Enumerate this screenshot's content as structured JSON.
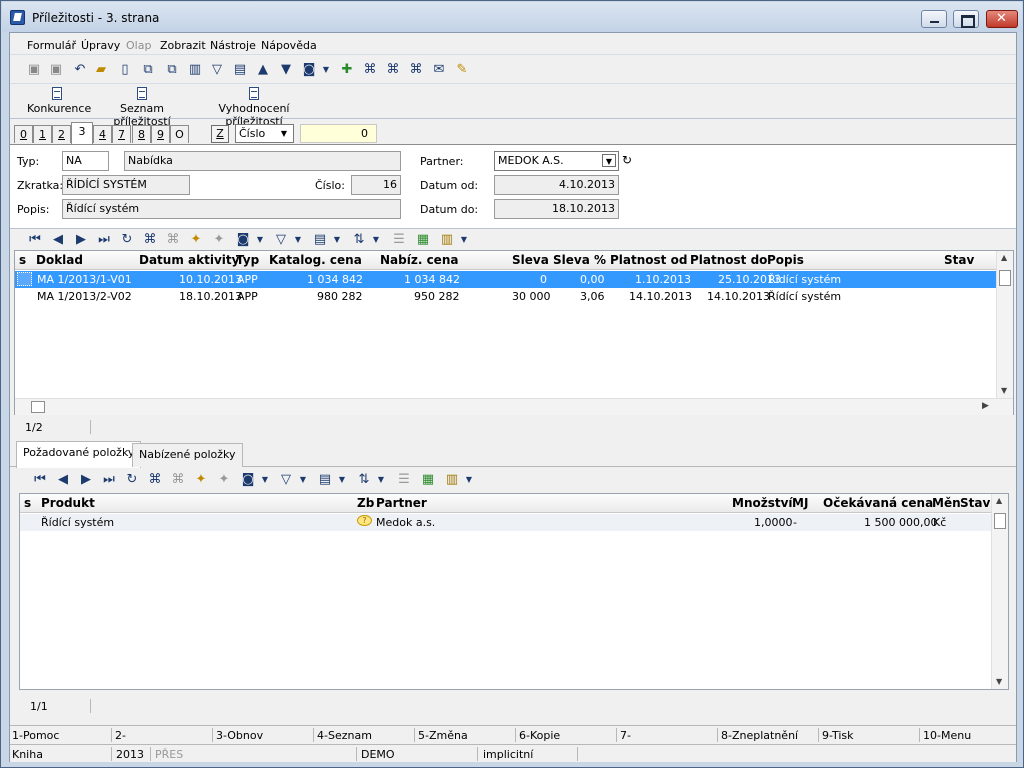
{
  "window": {
    "title": "Příležitosti - 3. strana"
  },
  "menu": [
    "Formulář",
    "Úpravy",
    "Olap",
    "Zobrazit",
    "Nástroje",
    "Nápověda"
  ],
  "actions": [
    "Konkurence",
    "Seznam příležitostí",
    "Vyhodnocení příležitostí"
  ],
  "tabs": [
    "0",
    "1",
    "2",
    "3",
    "4",
    "7",
    "8",
    "9",
    "O"
  ],
  "active_tab": "3",
  "filter": {
    "z_label": "Z",
    "sort_select": "Číslo",
    "number": "0"
  },
  "form": {
    "typ_label": "Typ:",
    "typ_code": "NA",
    "typ_name": "Nabídka",
    "zkratka_label": "Zkratka:",
    "zkratka": "ŘÍDÍCÍ SYSTÉM",
    "cislo_label": "Číslo:",
    "cislo": "16",
    "popis_label": "Popis:",
    "popis": "Řídící systém",
    "partner_label": "Partner:",
    "partner": "MEDOK A.S.",
    "datum_od_label": "Datum od:",
    "datum_od": "4.10.2013",
    "datum_do_label": "Datum do:",
    "datum_do": "18.10.2013"
  },
  "offers": {
    "columns": [
      "s",
      "Doklad",
      "Datum aktivity",
      "Typ",
      "Katalog. cena",
      "Nabíz. cena",
      "Sleva",
      "Sleva %",
      "Platnost od",
      "Platnost do",
      "Popis",
      "Stav"
    ],
    "rows": [
      {
        "doklad": "MA 1/2013/1-V01",
        "datum": "10.10.2013",
        "typ": "APP",
        "katalog": "1 034 842",
        "nabiz": "1 034 842",
        "sleva": "0",
        "sleva_pct": "0,00",
        "od": "1.10.2013",
        "do": "25.10.2013",
        "popis": "Řídící systém",
        "stav": ""
      },
      {
        "doklad": "MA 1/2013/2-V02",
        "datum": "18.10.2013",
        "typ": "APP",
        "katalog": "980 282",
        "nabiz": "950 282",
        "sleva": "30 000",
        "sleva_pct": "3,06",
        "od": "14.10.2013",
        "do": "14.10.2013",
        "popis": "Řídící systém",
        "stav": ""
      }
    ],
    "count": "1/2"
  },
  "bottom_tabs": [
    "Požadované položky",
    "Nabízené položky"
  ],
  "items": {
    "columns": [
      "s",
      "Produkt",
      "Zb",
      "Partner",
      "Množství",
      "MJ",
      "Očekávaná cena",
      "Měn",
      "Stav"
    ],
    "rows": [
      {
        "produkt": "Řídící systém",
        "partner": "Medok a.s.",
        "mnozstvi": "1,0000",
        "mj": "-",
        "cena": "1 500 000,00",
        "men": "Kč",
        "stav": ""
      }
    ],
    "count": "1/1"
  },
  "fkeys": [
    "1-Pomoc",
    "2-",
    "3-Obnov",
    "4-Seznam",
    "5-Změna",
    "6-Kopie",
    "7-",
    "8-Zneplatnění",
    "9-Tisk",
    "10-Menu"
  ],
  "status": {
    "module": "Kniha",
    "year": "2013",
    "mode": "PŘES",
    "db": "DEMO",
    "implicit": "implicitní"
  }
}
